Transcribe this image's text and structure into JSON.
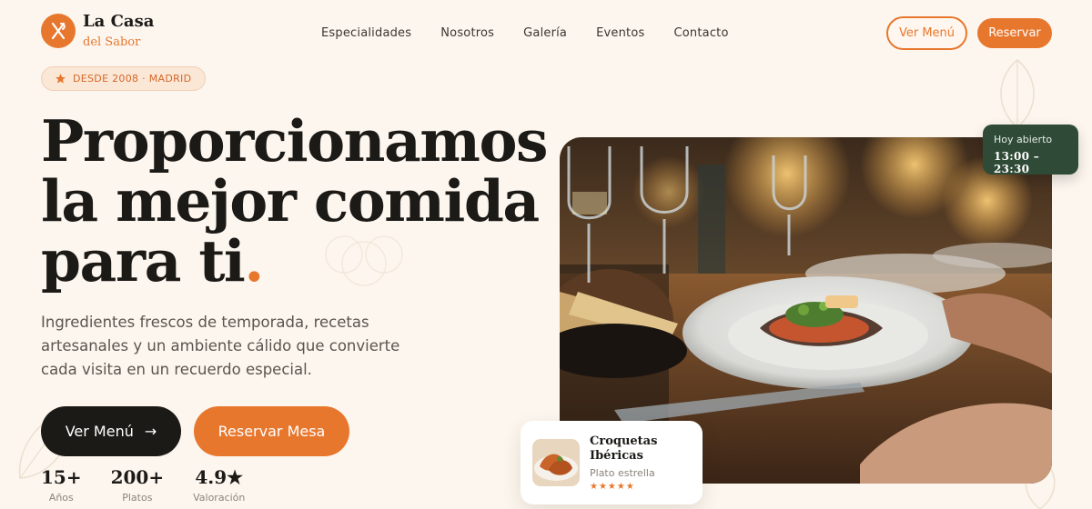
{
  "header": {
    "logo_title": "La Casa",
    "logo_subtitle": "del Sabor",
    "nav": [
      "Especialidades",
      "Nosotros",
      "Galería",
      "Eventos",
      "Contacto"
    ],
    "menu_button": "Ver Menú",
    "reserve_button": "Reservar"
  },
  "badge": {
    "text": "DESDE 2008 · MADRID",
    "icon": "star-icon"
  },
  "hero": {
    "title_line1": "Proporcionamos",
    "title_line2": "la mejor comida",
    "title_line3": "para ti",
    "title_dot": ".",
    "description": "Ingredientes frescos de temporada, recetas artesanales y un ambiente cálido que convierte cada visita en un recuerdo especial.",
    "primary_button": "Ver Menú",
    "primary_arrow": "→",
    "secondary_button": "Reservar Mesa"
  },
  "stats": [
    {
      "value": "15+",
      "label": "Años"
    },
    {
      "value": "200+",
      "label": "Platos"
    },
    {
      "value": "4.9★",
      "label": "Valoración"
    }
  ],
  "hours": {
    "label": "Hoy abierto",
    "value": "13:00 – 23:30"
  },
  "dish_card": {
    "name": "Croquetas Ibéricas",
    "tag": "Plato estrella",
    "stars": "★★★★★"
  },
  "colors": {
    "accent": "#e8772e",
    "dark": "#1c1a17",
    "background": "#fcf6ee",
    "hours_bg": "#2f4a36"
  }
}
